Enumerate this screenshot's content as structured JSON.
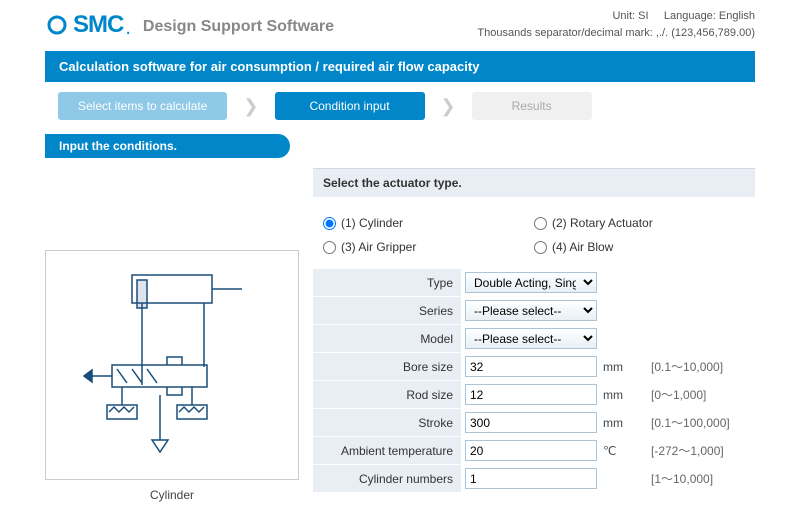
{
  "header": {
    "logo_text": "SMC",
    "app_title": "Design Support Software",
    "unit_label": "Unit:",
    "unit_value": "SI",
    "lang_label": "Language:",
    "lang_value": "English",
    "separator_note": "Thousands separator/decimal mark: ,./. (123,456,789.00)"
  },
  "banner": "Calculation software for air consumption / required air flow capacity",
  "steps": {
    "s1": "Select items to calculate",
    "s2": "Condition input",
    "s3": "Results"
  },
  "section_label": "Input the conditions.",
  "diagram_caption": "Cylinder",
  "actuator": {
    "heading": "Select the actuator type.",
    "opt1": "(1) Cylinder",
    "opt2": "(2) Rotary Actuator",
    "opt3": "(3) Air Gripper",
    "opt4": "(4) Air Blow"
  },
  "fields": {
    "type": {
      "label": "Type",
      "value": "Double Acting, Single Rod"
    },
    "series": {
      "label": "Series",
      "value": "--Please select--"
    },
    "model": {
      "label": "Model",
      "value": "--Please select--"
    },
    "bore": {
      "label": "Bore size",
      "value": "32",
      "unit": "mm",
      "range": "[0.1～10,000]"
    },
    "rod": {
      "label": "Rod size",
      "value": "12",
      "unit": "mm",
      "range": "[0～1,000]"
    },
    "stroke": {
      "label": "Stroke",
      "value": "300",
      "unit": "mm",
      "range": "[0.1～100,000]"
    },
    "temp": {
      "label": "Ambient temperature",
      "value": "20",
      "unit": "℃",
      "range": "[-272～1,000]"
    },
    "cylnum": {
      "label": "Cylinder numbers",
      "value": "1",
      "unit": "",
      "range": "[1～10,000]"
    }
  }
}
